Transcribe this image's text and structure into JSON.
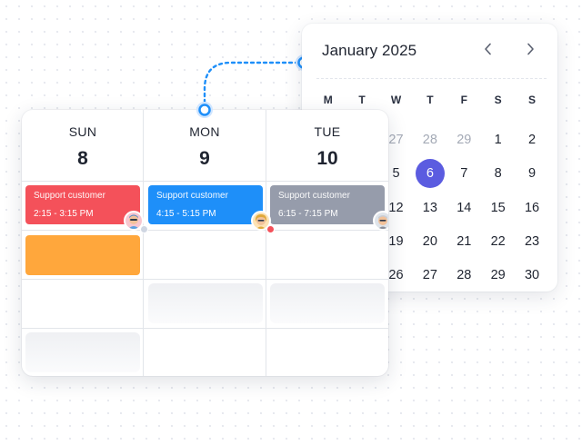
{
  "month_calendar": {
    "title": "January 2025",
    "prev_icon": "chevron-left-icon",
    "next_icon": "chevron-right-icon",
    "weekdays": [
      "M",
      "T",
      "W",
      "T",
      "F",
      "S",
      "S"
    ],
    "weeks": [
      [
        {
          "d": "",
          "m": true
        },
        {
          "d": "",
          "m": true
        },
        {
          "d": "27",
          "m": true
        },
        {
          "d": "28",
          "m": true
        },
        {
          "d": "29",
          "m": true
        },
        {
          "d": "1",
          "m": false
        },
        {
          "d": "2",
          "m": false
        }
      ],
      [
        {
          "d": "",
          "m": false
        },
        {
          "d": "",
          "m": false
        },
        {
          "d": "5",
          "m": false
        },
        {
          "d": "6",
          "m": false,
          "selected": true
        },
        {
          "d": "7",
          "m": false
        },
        {
          "d": "8",
          "m": false
        },
        {
          "d": "9",
          "m": false
        }
      ],
      [
        {
          "d": "",
          "m": false
        },
        {
          "d": "",
          "m": false
        },
        {
          "d": "12",
          "m": false
        },
        {
          "d": "13",
          "m": false
        },
        {
          "d": "14",
          "m": false
        },
        {
          "d": "15",
          "m": false
        },
        {
          "d": "16",
          "m": false
        }
      ],
      [
        {
          "d": "",
          "m": false
        },
        {
          "d": "",
          "m": false
        },
        {
          "d": "19",
          "m": false
        },
        {
          "d": "20",
          "m": false
        },
        {
          "d": "21",
          "m": false
        },
        {
          "d": "22",
          "m": false
        },
        {
          "d": "23",
          "m": false
        }
      ],
      [
        {
          "d": "",
          "m": false
        },
        {
          "d": "",
          "m": false
        },
        {
          "d": "26",
          "m": false
        },
        {
          "d": "27",
          "m": false
        },
        {
          "d": "28",
          "m": false
        },
        {
          "d": "29",
          "m": false
        },
        {
          "d": "30",
          "m": false
        }
      ]
    ],
    "accent_color": "#5b5ce0"
  },
  "week_view": {
    "days": [
      {
        "name": "SUN",
        "number": "8"
      },
      {
        "name": "MON",
        "number": "9"
      },
      {
        "name": "TUE",
        "number": "10"
      }
    ],
    "events": [
      {
        "title": "Support customer",
        "time": "2:15 - 3:15 PM",
        "color": "#f4515a",
        "avatar": "avatar-icon",
        "badge_color": "#cfd6e2"
      },
      {
        "title": "Support customer",
        "time": "4:15 - 5:15 PM",
        "color": "#1e8ff9",
        "avatar": "avatar-icon",
        "badge_color": "#f4515a"
      },
      {
        "title": "Support customer",
        "time": "6:15 - 7:15 PM",
        "color": "#969cab",
        "avatar": "avatar-icon",
        "badge_color": "#f4515a"
      }
    ],
    "extra_event_color": "#ffa73c"
  },
  "connector": {
    "color": "#1e8ff9"
  }
}
